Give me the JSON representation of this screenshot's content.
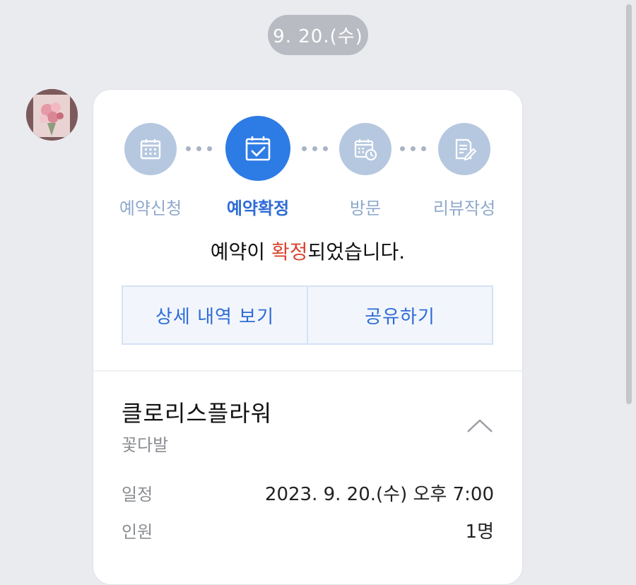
{
  "date_divider": "9. 20.(수)",
  "avatar_icon": "flower-bouquet-image",
  "steps": [
    {
      "label": "예약신청",
      "icon": "calendar-icon",
      "active": false
    },
    {
      "label": "예약확정",
      "icon": "calendar-check-icon",
      "active": true
    },
    {
      "label": "방문",
      "icon": "calendar-clock-icon",
      "active": false
    },
    {
      "label": "리뷰작성",
      "icon": "document-edit-icon",
      "active": false
    }
  ],
  "message": {
    "prefix": "예약이 ",
    "highlight": "확정",
    "suffix": "되었습니다."
  },
  "buttons": {
    "details": "상세 내역 보기",
    "share": "공유하기"
  },
  "shop": {
    "name": "클로리스플라워",
    "category": "꽃다발"
  },
  "details": [
    {
      "label": "일정",
      "value": "2023. 9. 20.(수) 오후 7:00"
    },
    {
      "label": "인원",
      "value": "1명"
    }
  ],
  "colors": {
    "accent": "#2d7be5",
    "highlight": "#d8452f",
    "inactive_step": "#b6c8e0",
    "background": "#e9ebef"
  }
}
